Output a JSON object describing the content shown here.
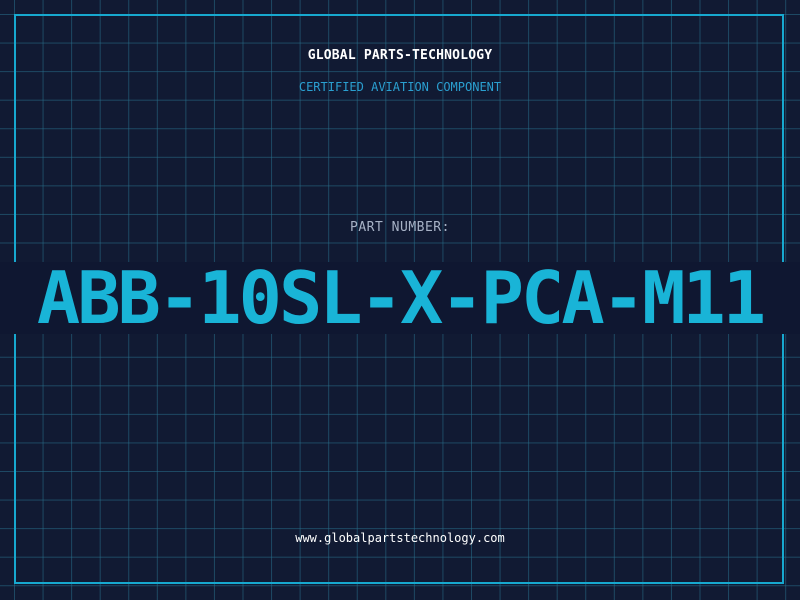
{
  "header": {
    "company": "GLOBAL PARTS-TECHNOLOGY",
    "tagline": "CERTIFIED AVIATION COMPONENT"
  },
  "part": {
    "label": "PART NUMBER:",
    "number": "ABB-10SL-X-PCA-M11"
  },
  "footer": {
    "website": "www.globalpartstechnology.com"
  },
  "colors": {
    "background": "#111a33",
    "grid": "#28708c",
    "accent": "#17a8cf",
    "part_number": "#19b4d7"
  }
}
